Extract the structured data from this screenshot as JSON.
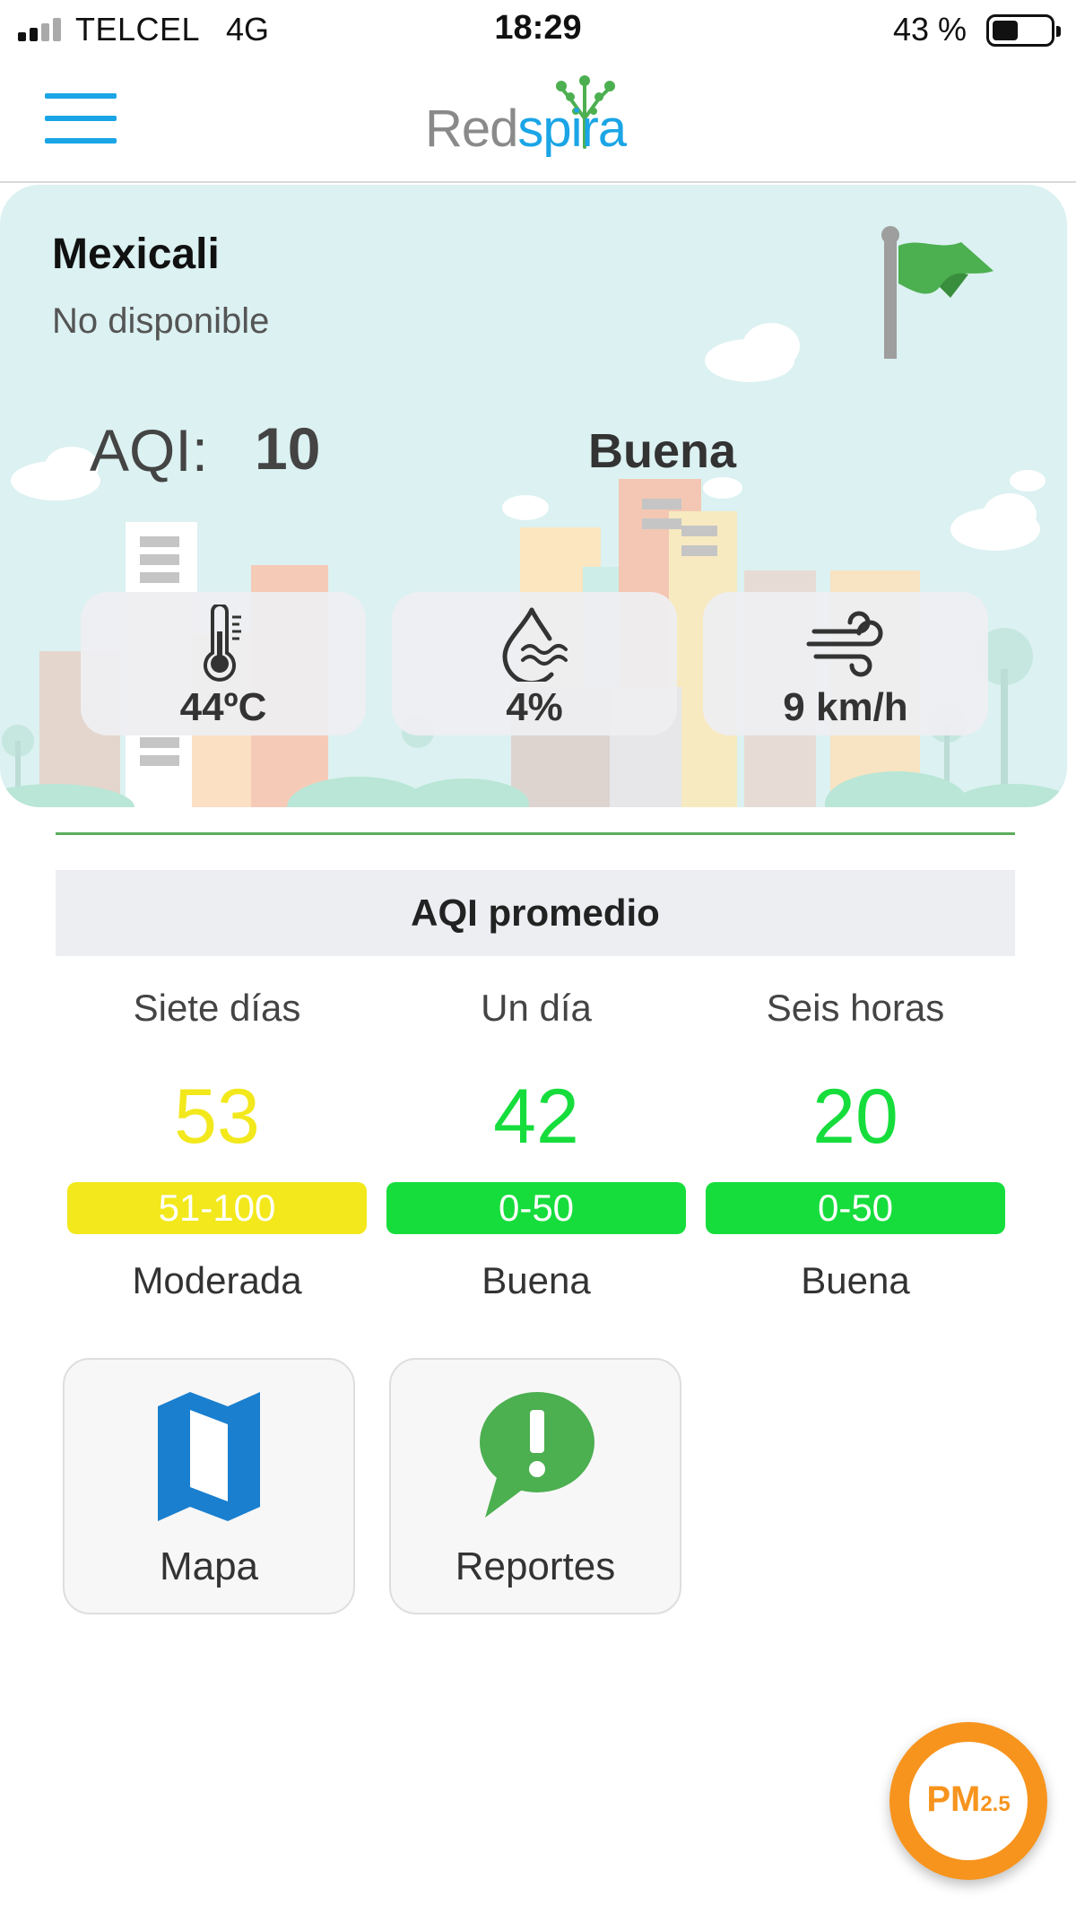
{
  "status_bar": {
    "carrier": "TELCEL",
    "network": "4G",
    "time": "18:29",
    "battery": "43 %",
    "battery_level": 0.43
  },
  "header": {
    "menu_icon": "hamburger-menu-icon",
    "logo_part1": "Red",
    "logo_part2": "spira",
    "accent_color": "#1aa5e6"
  },
  "station": {
    "city": "Mexicali",
    "status": "No disponible",
    "aqi_label": "AQI:",
    "aqi_value": "10",
    "category": "Buena",
    "flag_icon": "green-flag-icon",
    "flag_color": "#4caf50"
  },
  "metrics": [
    {
      "icon": "thermometer-icon",
      "value": "44ºC"
    },
    {
      "icon": "humidity-drop-icon",
      "value": "4%"
    },
    {
      "icon": "wind-icon",
      "value": "9 km/h"
    }
  ],
  "average": {
    "title": "AQI promedio",
    "columns": [
      {
        "period": "Siete días",
        "value": "53",
        "range": "51-100",
        "category": "Moderada",
        "color": "#f2e81c"
      },
      {
        "period": "Un día",
        "value": "42",
        "range": "0-50",
        "category": "Buena",
        "color": "#16dd3c"
      },
      {
        "period": "Seis horas",
        "value": "20",
        "range": "0-50",
        "category": "Buena",
        "color": "#16dd3c"
      }
    ]
  },
  "buttons": [
    {
      "label": "Mapa",
      "icon": "map-icon",
      "color": "#1a7fcf"
    },
    {
      "label": "Reportes",
      "icon": "report-alert-icon",
      "color": "#4caf50"
    }
  ],
  "fab": {
    "label": "PM",
    "sub": "2.5",
    "color": "#f7941d"
  }
}
